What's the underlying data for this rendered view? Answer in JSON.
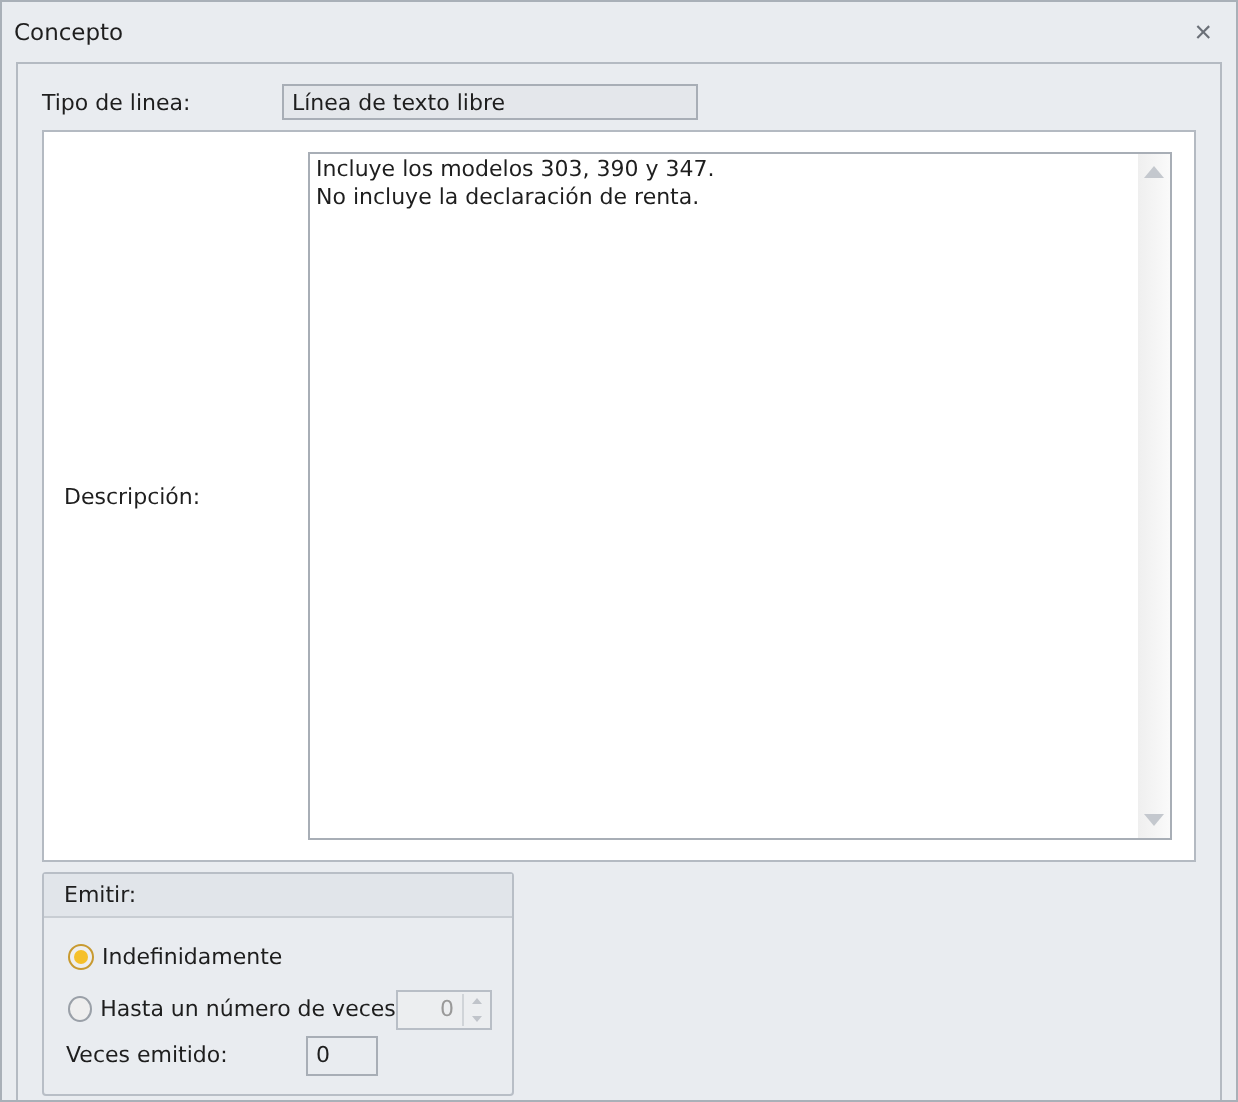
{
  "window": {
    "title": "Concepto",
    "close": "×"
  },
  "line_type": {
    "label": "Tipo de linea:",
    "value": "Línea de texto libre"
  },
  "description": {
    "label": "Descripción:",
    "lines": [
      "Incluye los modelos 303, 390 y 347.",
      "No incluye la declaración de renta."
    ]
  },
  "emit": {
    "title": "Emitir:",
    "options": [
      {
        "label": "Indefinidamente",
        "selected": true,
        "kind": "plain"
      },
      {
        "label": "Hasta un número de veces",
        "selected": false,
        "kind": "spin",
        "value": "0",
        "disabled": true
      }
    ],
    "count": {
      "label": "Veces emitido:",
      "value": "0"
    }
  }
}
